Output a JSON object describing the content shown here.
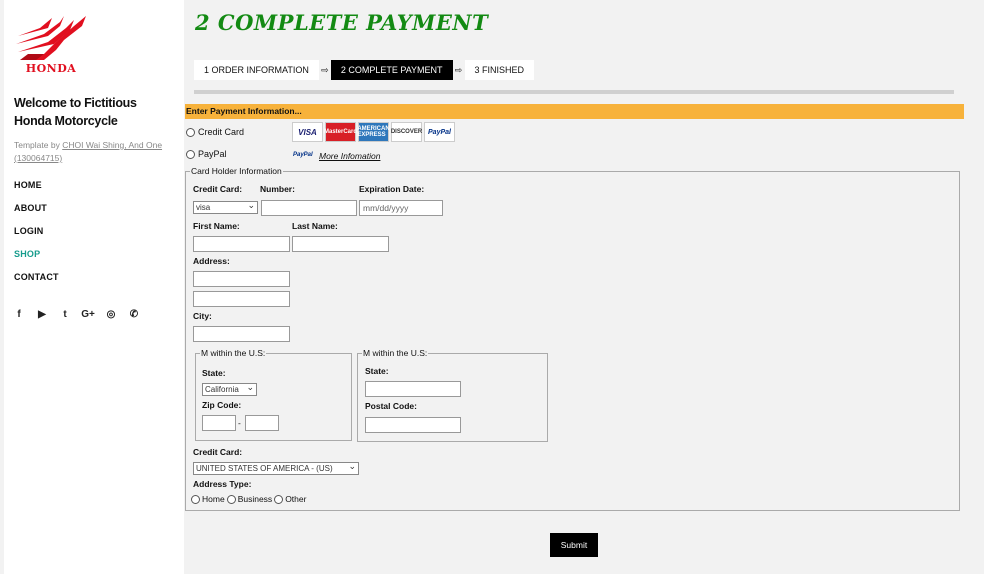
{
  "brand": {
    "logo_text": "HONDA",
    "accent": "#e10f1f"
  },
  "sidebar": {
    "welcome": "Welcome to Fictitious Honda Motorcycle",
    "template_prefix": "Template by ",
    "template_author": "CHOI Wai Shing, And One (130064715)",
    "nav": [
      {
        "label": "HOME"
      },
      {
        "label": "ABOUT"
      },
      {
        "label": "LOGIN"
      },
      {
        "label": "SHOP",
        "active": true
      },
      {
        "label": "CONTACT"
      }
    ],
    "social_icons": [
      "facebook-icon",
      "youtube-icon",
      "twitter-icon",
      "google-plus-icon",
      "whatsapp-icon",
      "wechat-icon"
    ],
    "social_glyphs": {
      "facebook": "f",
      "youtube": "▶",
      "twitter": "t",
      "google_plus": "G+",
      "whatsapp": "◎",
      "wechat": "✆"
    }
  },
  "page": {
    "title": "2 COMPLETE PAYMENT",
    "title_color": "#138a13",
    "steps": [
      {
        "label": "1 ORDER INFORMATION"
      },
      {
        "label": "2 COMPLETE PAYMENT",
        "active": true
      },
      {
        "label": "3 FINISHED"
      }
    ],
    "step_arrow": "⇨"
  },
  "payment": {
    "header": "Enter Payment Information...",
    "header_color": "#f7b23b",
    "credit_card_label": "Credit Card",
    "paypal_label": "PayPal",
    "cards": [
      "VISA",
      "MasterCard",
      "AMERICAN EXPRESS",
      "DISCOVER",
      "PayPal"
    ],
    "paypal_small": "PayPal",
    "more_info": "More Infomation"
  },
  "form": {
    "legend": "Card Holder Information",
    "credit_card_label": "Credit Card:",
    "credit_card_value": "visa",
    "number_label": "Number:",
    "number_value": "",
    "expiration_label": "Expiration Date:",
    "expiration_placeholder": "mm/dd/yyyy",
    "first_name_label": "First Name:",
    "last_name_label": "Last Name:",
    "address_label": "Address:",
    "city_label": "City:",
    "us_legend": "M within the U.S:",
    "us_state_label": "State:",
    "us_state_value": "California",
    "zip_label": "Zip Code:",
    "zip_dash": "-",
    "intl_legend": "M within the U.S:",
    "intl_state_label": "State:",
    "postal_label": "Postal Code:",
    "country_label": "Credit Card:",
    "country_value": "UNITED STATES OF AMERICA - (US)",
    "address_type_label": "Address Type:",
    "address_types": [
      "Home",
      "Business",
      "Other"
    ]
  },
  "submit_label": "Submit"
}
